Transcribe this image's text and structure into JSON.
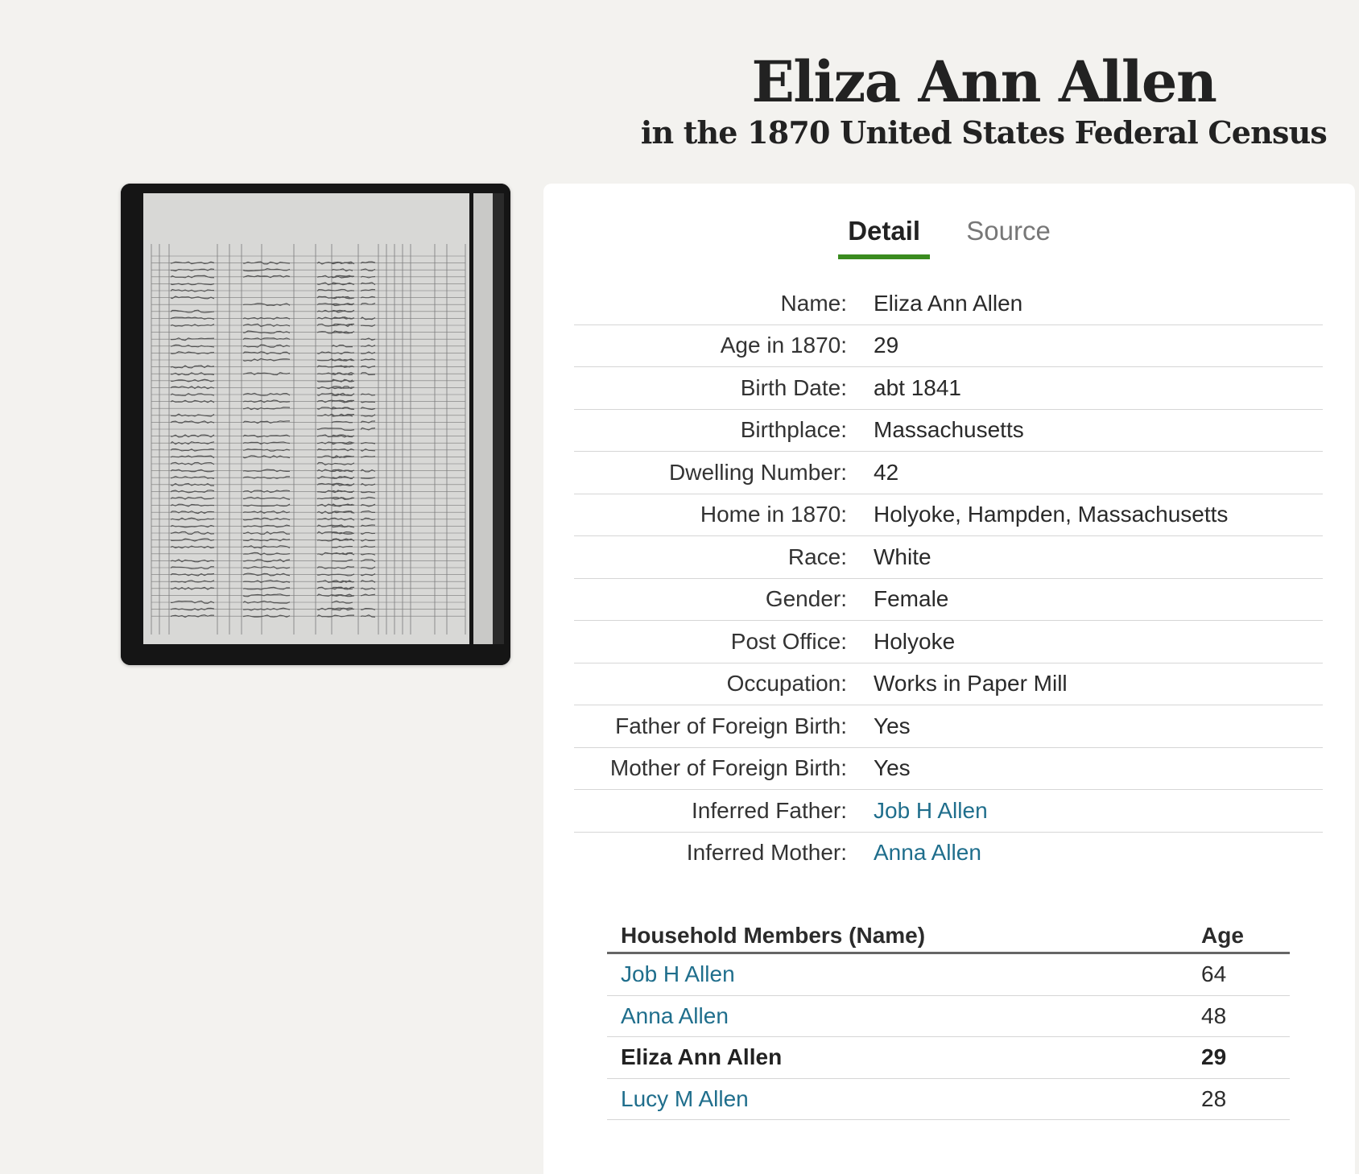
{
  "header": {
    "title": "Eliza Ann Allen",
    "subtitle": "in the 1870 United States Federal Census"
  },
  "tabs": [
    {
      "label": "Detail",
      "active": true
    },
    {
      "label": "Source",
      "active": false
    }
  ],
  "details": [
    {
      "label": "Name:",
      "value": "Eliza Ann Allen",
      "link": false
    },
    {
      "label": "Age in 1870:",
      "value": "29",
      "link": false
    },
    {
      "label": "Birth Date:",
      "value": "abt 1841",
      "link": false
    },
    {
      "label": "Birthplace:",
      "value": "Massachusetts",
      "link": false
    },
    {
      "label": "Dwelling Number:",
      "value": "42",
      "link": false
    },
    {
      "label": "Home in 1870:",
      "value": "Holyoke, Hampden, Massachusetts",
      "link": false
    },
    {
      "label": "Race:",
      "value": "White",
      "link": false
    },
    {
      "label": "Gender:",
      "value": "Female",
      "link": false
    },
    {
      "label": "Post Office:",
      "value": "Holyoke",
      "link": false
    },
    {
      "label": "Occupation:",
      "value": "Works in Paper Mill",
      "link": false
    },
    {
      "label": "Father of Foreign Birth:",
      "value": "Yes",
      "link": false
    },
    {
      "label": "Mother of Foreign Birth:",
      "value": "Yes",
      "link": false
    },
    {
      "label": "Inferred Father:",
      "value": "Job H Allen",
      "link": true
    },
    {
      "label": "Inferred Mother:",
      "value": "Anna Allen",
      "link": true
    }
  ],
  "household": {
    "name_header": "Household Members (Name)",
    "age_header": "Age",
    "members": [
      {
        "name": "Job H Allen",
        "age": "64",
        "current": false
      },
      {
        "name": "Anna Allen",
        "age": "48",
        "current": false
      },
      {
        "name": "Eliza Ann Allen",
        "age": "29",
        "current": true
      },
      {
        "name": "Lucy M Allen",
        "age": "28",
        "current": false
      }
    ]
  },
  "colors": {
    "background": "#f3f2ef",
    "link": "#1f6e8c",
    "active_tab_underline": "#3a8b1f"
  },
  "icons": {
    "record_image": "census-page-thumbnail"
  }
}
